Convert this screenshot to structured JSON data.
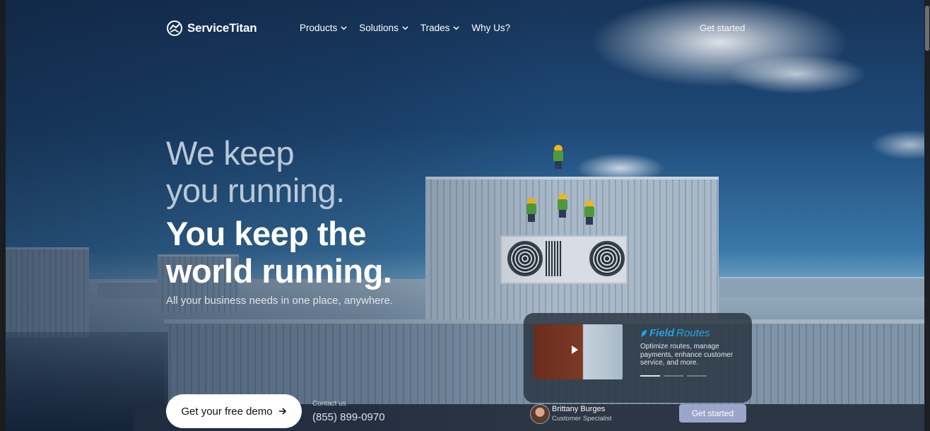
{
  "nav": {
    "logo_text": "ServiceTitan",
    "links": [
      {
        "label": "Products"
      },
      {
        "label": "Solutions"
      },
      {
        "label": "Trades"
      },
      {
        "label": "Why Us?"
      }
    ],
    "cta_label": "Get started"
  },
  "hero": {
    "line1": "We keep",
    "line2": "you running.",
    "line3": "You keep the",
    "line4": "world running.",
    "subtitle": "All your business needs in one place, anywhere."
  },
  "promo": {
    "brand_part1": "Field",
    "brand_part2": "Routes",
    "description": "Optimize routes, manage payments, enhance customer service, and more.",
    "slides_total": 3,
    "active_slide": 1
  },
  "bottom_bar": {
    "demo_label": "Get your free demo",
    "contact_label": "Contact us",
    "phone": "(855) 899-0970",
    "rep_name": "Brittany Burges",
    "rep_title": "Customer Specialist",
    "start_label": "Get started"
  },
  "colors": {
    "brand_accent": "#1fa6e8",
    "start_button": "#9aa6c9",
    "hero_primary": "#ffffff",
    "hero_secondary": "#b9c8d8"
  }
}
